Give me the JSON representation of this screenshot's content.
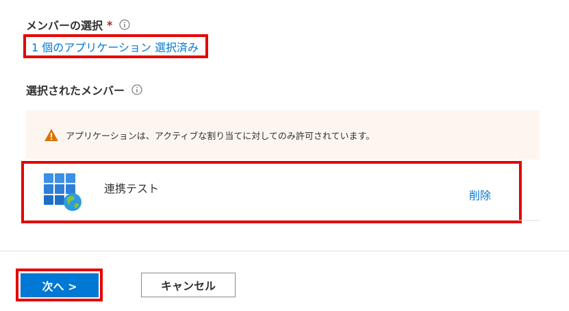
{
  "members": {
    "label": "メンバーの選択",
    "required_mark": "*",
    "selected_link": "1 個のアプリケーション 選択済み"
  },
  "selected_members": {
    "label": "選択されたメンバー",
    "warning": "アプリケーションは、アクティブな割り当てに対してのみ許可されています。",
    "items": [
      {
        "name": "連携テスト",
        "remove_label": "削除",
        "icon": "enterprise-app-icon"
      }
    ]
  },
  "footer": {
    "next_label": "次へ >",
    "cancel_label": "キャンセル"
  },
  "colors": {
    "accent": "#0078d4",
    "highlight": "#e60000",
    "warning": "#d9730d",
    "warning_bg": "#fdf6f0"
  }
}
